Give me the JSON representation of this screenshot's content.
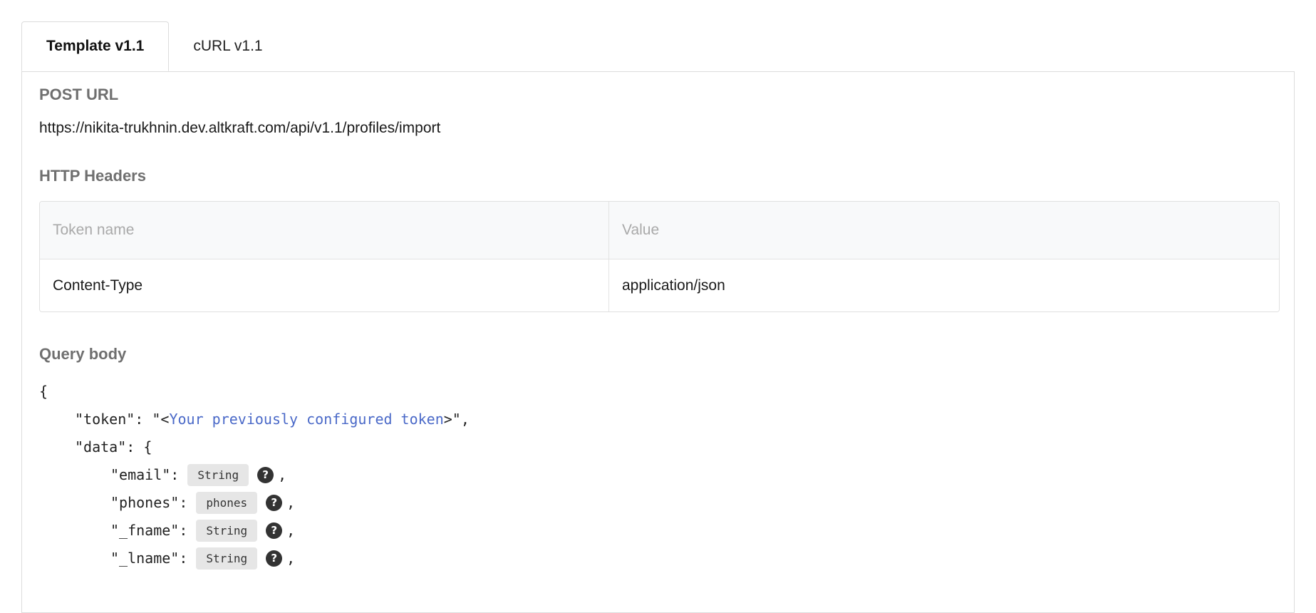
{
  "tabs": [
    {
      "label": "Template v1.1",
      "active": true
    },
    {
      "label": "cURL v1.1",
      "active": false
    }
  ],
  "post_url": {
    "title": "POST URL",
    "url": "https://nikita-trukhnin.dev.altkraft.com/api/v1.1/profiles/import"
  },
  "http_headers": {
    "title": "HTTP Headers",
    "columns": [
      "Token name",
      "Value"
    ],
    "rows": [
      {
        "name": "Content-Type",
        "value": "application/json"
      }
    ]
  },
  "query_body": {
    "title": "Query body",
    "open_brace": "{",
    "token_key": "\"token\": \"<",
    "token_placeholder": "Your previously configured token",
    "token_end": ">\",",
    "data_key": "\"data\": {",
    "fields": [
      {
        "key": "\"email\":",
        "type": "String"
      },
      {
        "key": "\"phones\":",
        "type": "phones"
      },
      {
        "key": "\"_fname\":",
        "type": "String"
      },
      {
        "key": "\"_lname\":",
        "type": "String"
      }
    ],
    "help_glyph": "?",
    "comma": ","
  },
  "colors": {
    "token_placeholder": "#4a69c8",
    "section_title": "#6f6f6f",
    "badge_bg": "#e6e6e6"
  }
}
